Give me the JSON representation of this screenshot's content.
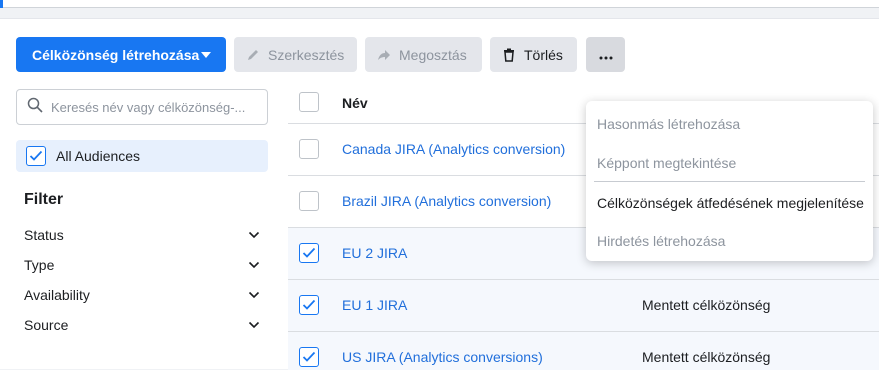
{
  "toolbar": {
    "create_label": "Célközönség létrehozása",
    "edit_label": "Szerkesztés",
    "share_label": "Megosztás",
    "delete_label": "Törlés",
    "more_label": "···"
  },
  "sidebar": {
    "search_placeholder": "Keresés név vagy célközönség-...",
    "all_audiences_label": "All Audiences",
    "filter_title": "Filter",
    "filters": [
      {
        "label": "Status"
      },
      {
        "label": "Type"
      },
      {
        "label": "Availability"
      },
      {
        "label": "Source"
      }
    ]
  },
  "table": {
    "name_header": "Név",
    "rows": [
      {
        "name": "Canada JIRA (Analytics conversion)",
        "type": "",
        "checked": false
      },
      {
        "name": "Brazil JIRA (Analytics conversion)",
        "type": "",
        "checked": false
      },
      {
        "name": "EU 2 JIRA",
        "type": "Mentett célközönség",
        "checked": true
      },
      {
        "name": "EU 1 JIRA",
        "type": "Mentett célközönség",
        "checked": true
      },
      {
        "name": "US JIRA (Analytics conversions)",
        "type": "Mentett célközönség",
        "checked": true
      }
    ]
  },
  "more_menu": {
    "items": [
      {
        "label": "Hasonmás létrehozása",
        "enabled": false
      },
      {
        "label": "Képpont megtekintése",
        "enabled": false
      },
      {
        "label": "Célközönségek átfedésének megjelenítése",
        "enabled": true
      },
      {
        "label": "Hirdetés létrehozása",
        "enabled": false
      }
    ]
  },
  "colors": {
    "accent": "#1877f2",
    "link": "#216fdb",
    "selected_row": "#f5f8fd",
    "disabled_text": "#8d949e"
  }
}
